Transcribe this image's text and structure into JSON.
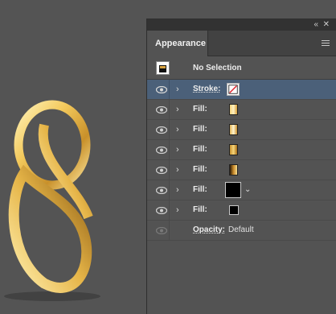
{
  "panel": {
    "tab_label": "Appearance",
    "header": {
      "title": "No Selection"
    },
    "rows": [
      {
        "type": "stroke",
        "label": "Stroke:"
      },
      {
        "type": "fill",
        "label": "Fill:"
      },
      {
        "type": "fill",
        "label": "Fill:"
      },
      {
        "type": "fill",
        "label": "Fill:"
      },
      {
        "type": "fill",
        "label": "Fill:"
      },
      {
        "type": "fill",
        "label": "Fill:"
      },
      {
        "type": "fill",
        "label": "Fill:"
      }
    ],
    "opacity": {
      "label": "Opacity:",
      "value": "Default"
    }
  },
  "colors": {
    "selected_row": "#4b6079",
    "panel_bg": "#535353",
    "canvas_bg": "#545454",
    "gold": "#e8b84a"
  },
  "icons": {
    "collapse": "double-chevron-left-icon",
    "close": "close-icon",
    "menu": "hamburger-menu-icon",
    "visibility": "eye-icon",
    "expand": "chevron-right-icon",
    "dropdown": "chevron-down-icon"
  }
}
